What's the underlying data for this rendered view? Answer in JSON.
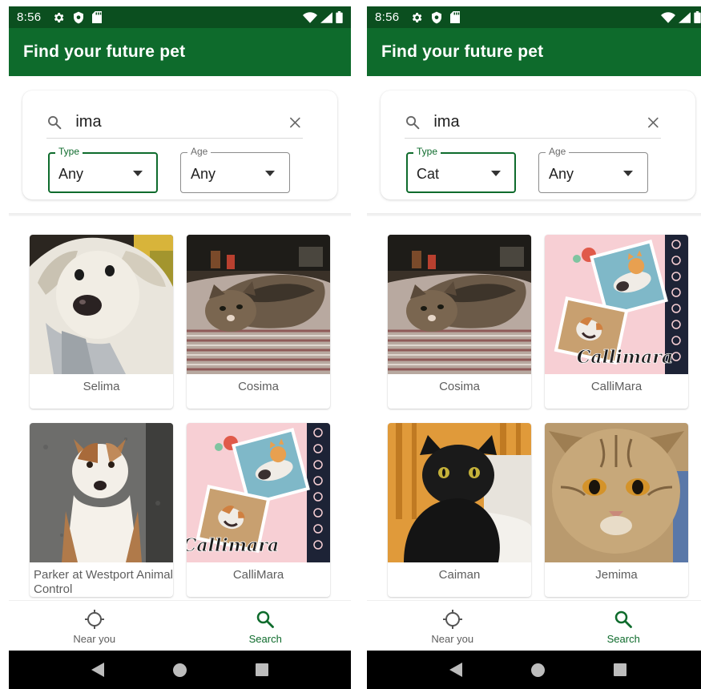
{
  "colors": {
    "status_bar": "#0b4f1f",
    "app_bar": "#0e6b2c",
    "accent": "#0e6b2c"
  },
  "screens": [
    {
      "status": {
        "time": "8:56"
      },
      "app_title": "Find your future pet",
      "search": {
        "query": "ima",
        "clear_icon": "close-icon"
      },
      "filters": {
        "type": {
          "label": "Type",
          "value": "Any"
        },
        "age": {
          "label": "Age",
          "value": "Any"
        }
      },
      "pets": [
        {
          "name": "Selima",
          "photo": "white-dog-photo"
        },
        {
          "name": "Cosima",
          "photo": "tabby-cat-on-bed-photo"
        },
        {
          "name": "Parker at Westport Animal Control",
          "photo": "brown-white-dog-photo"
        },
        {
          "name": "CalliMara",
          "photo": "calico-cat-collage-photo"
        }
      ],
      "nav": [
        {
          "label": "Near you",
          "icon": "crosshair-icon"
        },
        {
          "label": "Search",
          "icon": "search-icon"
        }
      ],
      "collage_text": "Callimara"
    },
    {
      "status": {
        "time": "8:56"
      },
      "app_title": "Find your future pet",
      "search": {
        "query": "ima",
        "clear_icon": "close-icon"
      },
      "filters": {
        "type": {
          "label": "Type",
          "value": "Cat"
        },
        "age": {
          "label": "Age",
          "value": "Any"
        }
      },
      "pets": [
        {
          "name": "Cosima",
          "photo": "tabby-cat-on-bed-photo"
        },
        {
          "name": "CalliMara",
          "photo": "calico-cat-collage-photo"
        },
        {
          "name": "Caiman",
          "photo": "black-cat-photo"
        },
        {
          "name": "Jemima",
          "photo": "tabby-cat-closeup-photo"
        }
      ],
      "nav": [
        {
          "label": "Near you",
          "icon": "crosshair-icon"
        },
        {
          "label": "Search",
          "icon": "search-icon"
        }
      ],
      "collage_text": "Callimara"
    }
  ]
}
